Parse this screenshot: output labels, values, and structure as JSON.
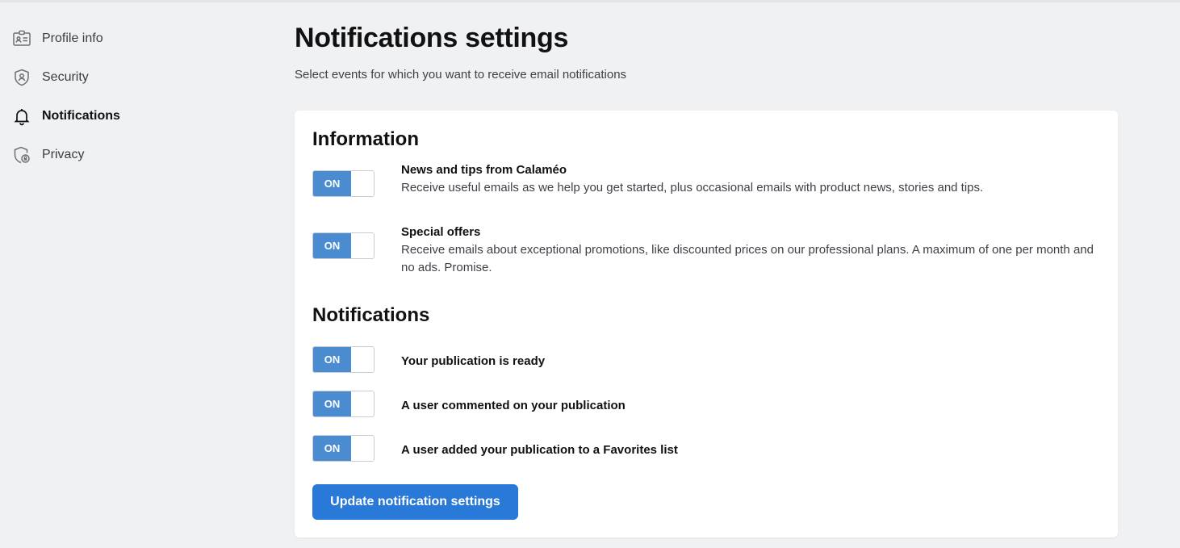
{
  "sidebar": {
    "items": [
      {
        "label": "Profile info",
        "icon": "id-card-icon"
      },
      {
        "label": "Security",
        "icon": "shield-icon"
      },
      {
        "label": "Notifications",
        "icon": "bell-icon",
        "active": true
      },
      {
        "label": "Privacy",
        "icon": "shield-lock-icon"
      }
    ]
  },
  "header": {
    "title": "Notifications settings",
    "subtitle": "Select events for which you want to receive email notifications"
  },
  "sections": {
    "information": {
      "title": "Information",
      "options": [
        {
          "title": "News and tips from Calaméo",
          "description": "Receive useful emails as we help you get started, plus occasional emails with product news, stories and tips.",
          "toggle": "ON"
        },
        {
          "title": "Special offers",
          "description": "Receive emails about exceptional promotions, like discounted prices on our professional plans. A maximum of one per month and no ads. Promise.",
          "toggle": "ON"
        }
      ]
    },
    "notifications": {
      "title": "Notifications",
      "options": [
        {
          "title": "Your publication is ready",
          "toggle": "ON"
        },
        {
          "title": "A user commented on your publication",
          "toggle": "ON"
        },
        {
          "title": "A user added your publication to a Favorites list",
          "toggle": "ON"
        }
      ]
    }
  },
  "actions": {
    "update_label": "Update notification settings"
  },
  "colors": {
    "accent": "#2979d8",
    "toggle_on": "#4b8bd0",
    "background": "#f0f1f3"
  }
}
